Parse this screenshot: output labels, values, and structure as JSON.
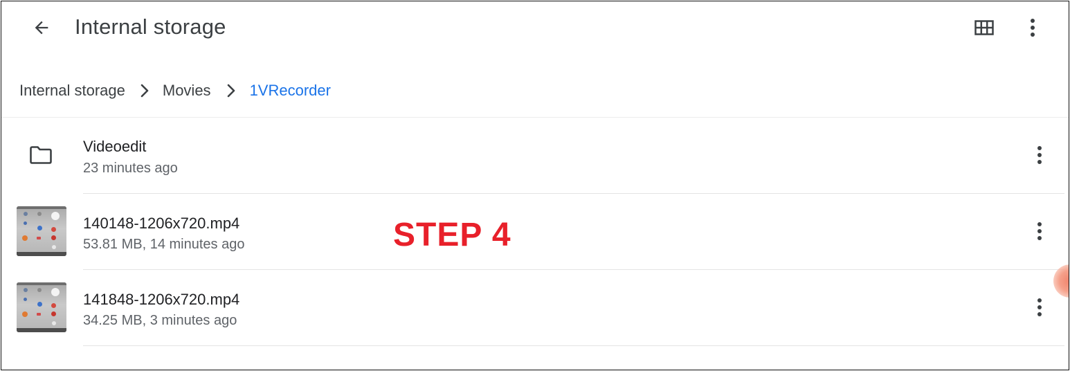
{
  "app_bar": {
    "title": "Internal storage",
    "back_icon": "arrow-back-icon",
    "grid_icon": "grid-view-icon",
    "more_icon": "more-vert-icon"
  },
  "breadcrumb": {
    "items": [
      "Internal storage",
      "Movies",
      "1VRecorder"
    ],
    "separator_icon": "chevron-right-icon",
    "active_color": "#1a73e8"
  },
  "files": [
    {
      "name": "Videoedit",
      "meta": "23 minutes ago",
      "type": "folder",
      "icon": "folder-icon"
    },
    {
      "name": "140148-1206x720.mp4",
      "meta": "53.81 MB, 14 minutes ago",
      "type": "video",
      "icon": "video-thumbnail"
    },
    {
      "name": "141848-1206x720.mp4",
      "meta": "34.25 MB, 3 minutes ago",
      "type": "video",
      "icon": "video-thumbnail"
    }
  ],
  "overlay": {
    "step_label": "STEP 4",
    "step_color": "#e8202a"
  }
}
